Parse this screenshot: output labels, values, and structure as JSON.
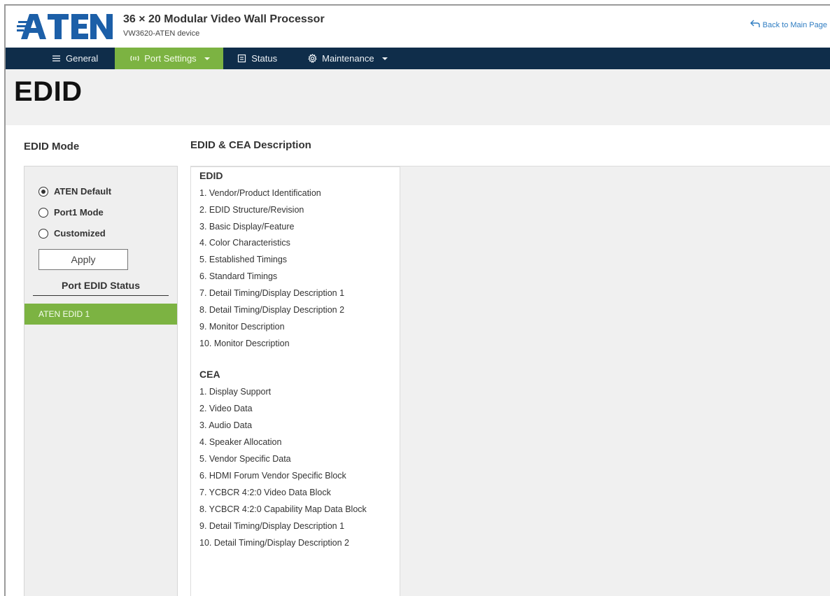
{
  "header": {
    "logo_text": "ATEN",
    "title": "36 × 20 Modular Video Wall Processor",
    "subtitle": "VW3620-ATEN device",
    "back_link": "Back to Main Page"
  },
  "nav": {
    "items": [
      {
        "label": "General",
        "icon": "list-icon"
      },
      {
        "label": "Port Settings",
        "icon": "port-icon",
        "active": true
      },
      {
        "label": "Status",
        "icon": "status-icon"
      },
      {
        "label": "Maintenance",
        "icon": "gear-icon"
      }
    ]
  },
  "page": {
    "title": "EDID"
  },
  "edid_mode": {
    "label": "EDID Mode",
    "options": [
      {
        "label": "ATEN Default",
        "selected": true
      },
      {
        "label": "Port1 Mode",
        "selected": false
      },
      {
        "label": "Customized",
        "selected": false
      }
    ],
    "apply_label": "Apply",
    "status_heading": "Port EDID Status",
    "status_items": [
      "ATEN EDID 1"
    ]
  },
  "description": {
    "label": "EDID & CEA Description",
    "edid": {
      "heading": "EDID",
      "items": [
        "1. Vendor/Product Identification",
        "2. EDID Structure/Revision",
        "3. Basic Display/Feature",
        "4. Color Characteristics",
        "5. Established Timings",
        "6. Standard Timings",
        "7. Detail Timing/Display Description 1",
        "8. Detail Timing/Display Description 2",
        "9. Monitor Description",
        "10. Monitor Description"
      ]
    },
    "cea": {
      "heading": "CEA",
      "items": [
        "1. Display Support",
        "2. Video Data",
        "3. Audio Data",
        "4. Speaker Allocation",
        "5. Vendor Specific Data",
        "6. HDMI Forum Vendor Specific Block",
        "7. YCBCR 4:2:0 Video Data Block",
        "8. YCBCR 4:2:0 Capability Map Data Block",
        "9. Detail Timing/Display Description 1",
        "10. Detail Timing/Display Description 2"
      ]
    }
  },
  "colors": {
    "nav_bg": "#0f2d4a",
    "accent_green": "#7cb342",
    "link_blue": "#2f7dc2",
    "logo_blue": "#1c5fa8"
  }
}
